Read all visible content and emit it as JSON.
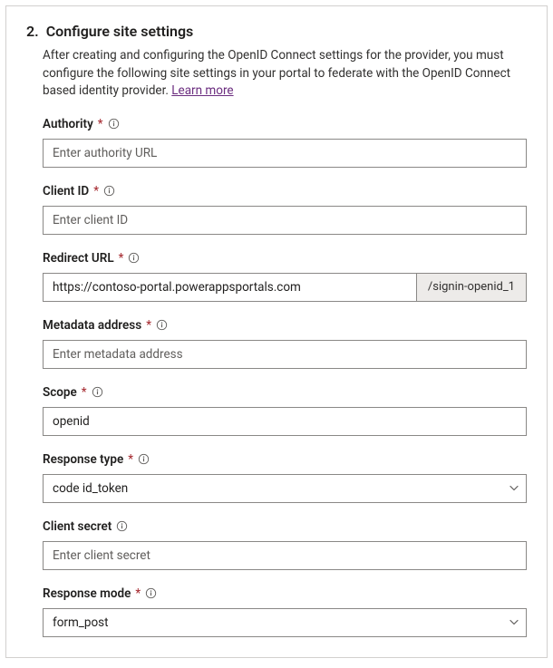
{
  "step": {
    "number": "2.",
    "title": "Configure site settings",
    "description": "After creating and configuring the OpenID Connect settings for the provider, you must configure the following site settings in your portal to federate with the OpenID Connect based identity provider.",
    "learn_more": "Learn more"
  },
  "fields": {
    "authority": {
      "label": "Authority",
      "placeholder": "Enter authority URL",
      "required": "*"
    },
    "client_id": {
      "label": "Client ID",
      "placeholder": "Enter client ID",
      "required": "*"
    },
    "redirect_url": {
      "label": "Redirect URL",
      "value": "https://contoso-portal.powerappsportals.com",
      "suffix": "/signin-openid_1",
      "required": "*"
    },
    "metadata_address": {
      "label": "Metadata address",
      "placeholder": "Enter metadata address",
      "required": "*"
    },
    "scope": {
      "label": "Scope",
      "value": "openid",
      "required": "*"
    },
    "response_type": {
      "label": "Response type",
      "value": "code id_token",
      "required": "*"
    },
    "client_secret": {
      "label": "Client secret",
      "placeholder": "Enter client secret"
    },
    "response_mode": {
      "label": "Response mode",
      "value": "form_post",
      "required": "*"
    }
  }
}
